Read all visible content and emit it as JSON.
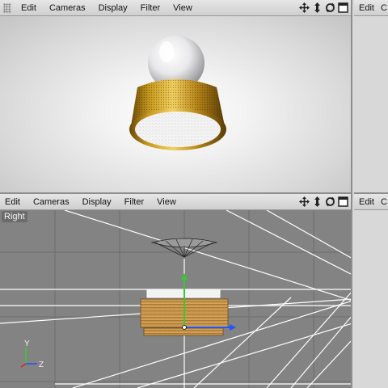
{
  "viewports": {
    "perspective": {
      "menu": [
        "Edit",
        "Cameras",
        "Display",
        "Filter",
        "View"
      ]
    },
    "right": {
      "label": "Right",
      "menu": [
        "Edit",
        "Cameras",
        "Display",
        "Filter",
        "View"
      ]
    },
    "top_right": {
      "menu": [
        "Edit",
        "C"
      ]
    },
    "bottom_right": {
      "menu": [
        "Edit",
        "C"
      ]
    }
  },
  "axis_indicator": {
    "y": "Y",
    "z": "Z"
  },
  "icons": [
    "move-icon",
    "zoom-icon",
    "rotate-icon",
    "maximize-icon"
  ],
  "colors": {
    "gold": "#c99a1e",
    "wood": "#c8964a",
    "axis_green": "#33cc33",
    "axis_blue": "#2255ff",
    "grid": "#6c6c6c"
  }
}
